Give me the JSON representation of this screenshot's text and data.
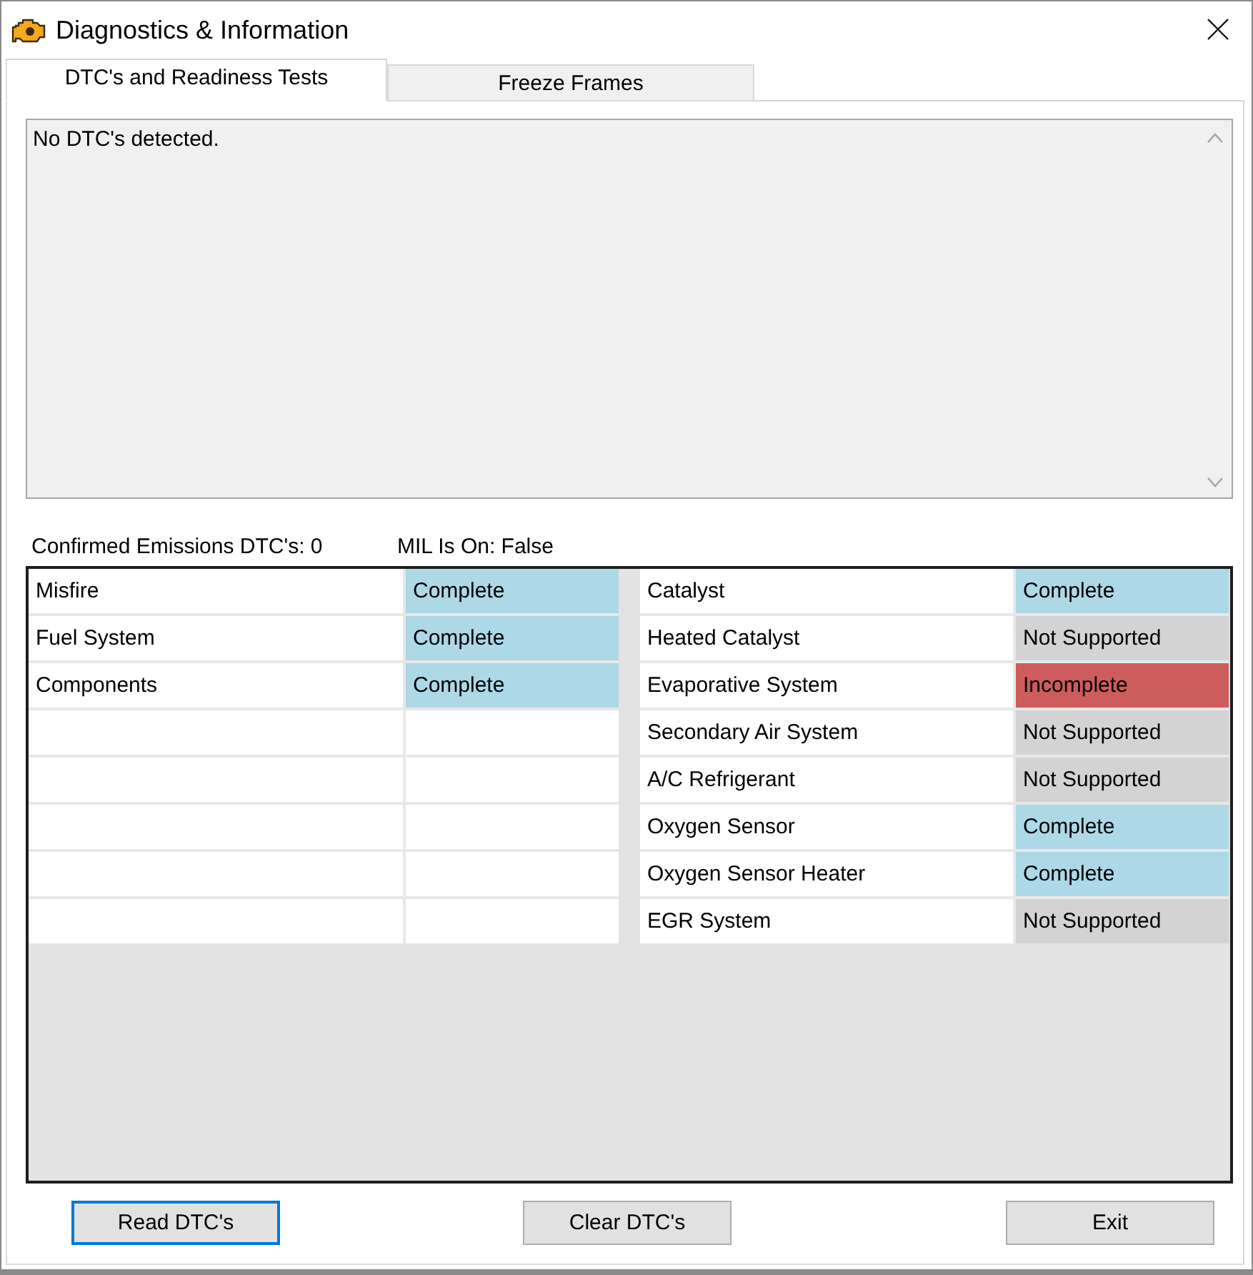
{
  "window": {
    "title": "Diagnostics & Information"
  },
  "tabs": [
    {
      "label": "DTC's and Readiness Tests",
      "selected": true
    },
    {
      "label": "Freeze Frames",
      "selected": false
    }
  ],
  "dtc_output": {
    "value": "No DTC's detected."
  },
  "summary": {
    "confirmed_emissions_dtcs": "Confirmed Emissions DTC's: 0",
    "mil_status": "MIL Is On: False"
  },
  "readiness": {
    "left": [
      {
        "test": "Misfire",
        "status": "Complete",
        "color": "#add8e6"
      },
      {
        "test": "Fuel System",
        "status": "Complete",
        "color": "#add8e6"
      },
      {
        "test": "Components",
        "status": "Complete",
        "color": "#add8e6"
      }
    ],
    "right": [
      {
        "test": "Catalyst",
        "status": "Complete",
        "color": "#add8e6"
      },
      {
        "test": "Heated Catalyst",
        "status": "Not Supported",
        "color": "#d3d3d3"
      },
      {
        "test": "Evaporative System",
        "status": "Incomplete",
        "color": "#cd5c5c"
      },
      {
        "test": "Secondary Air System",
        "status": "Not Supported",
        "color": "#d3d3d3"
      },
      {
        "test": "A/C Refrigerant",
        "status": "Not Supported",
        "color": "#d3d3d3"
      },
      {
        "test": "Oxygen Sensor",
        "status": "Complete",
        "color": "#add8e6"
      },
      {
        "test": "Oxygen Sensor Heater",
        "status": "Complete",
        "color": "#add8e6"
      },
      {
        "test": "EGR System",
        "status": "Not Supported",
        "color": "#d3d3d3"
      }
    ]
  },
  "buttons": [
    {
      "label": "Read DTC's",
      "focused": true
    },
    {
      "label": "Clear DTC's",
      "focused": false
    },
    {
      "label": "Exit",
      "focused": false
    }
  ]
}
